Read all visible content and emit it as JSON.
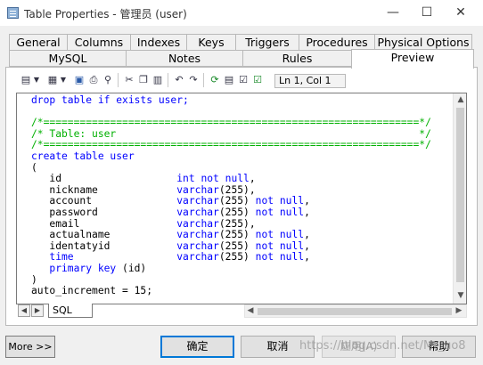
{
  "window": {
    "title": "Table Properties - 管理员 (user)",
    "minimize_glyph": "—",
    "maximize_glyph": "☐",
    "close_glyph": "✕"
  },
  "tabs_row1": [
    {
      "label": "General"
    },
    {
      "label": "Columns"
    },
    {
      "label": "Indexes"
    },
    {
      "label": "Keys"
    },
    {
      "label": "Triggers"
    },
    {
      "label": "Procedures"
    },
    {
      "label": "Physical Options"
    }
  ],
  "tabs_row2": [
    {
      "label": "MySQL"
    },
    {
      "label": "Notes"
    },
    {
      "label": "Rules"
    },
    {
      "label": "Preview",
      "active": true
    }
  ],
  "toolbar": {
    "icons": [
      "edit-menu-icon",
      "format-menu-icon",
      "save-icon",
      "print-icon",
      "find-icon",
      "cut-icon",
      "copy-icon",
      "paste-icon",
      "undo-icon",
      "redo-icon",
      "refresh-icon",
      "show-ddl-icon",
      "options-icon",
      "check-icon"
    ],
    "cursor_position": "Ln 1, Col 1"
  },
  "editor": {
    "lines": [
      [
        {
          "t": "drop table if exists user;",
          "c": "kw"
        }
      ],
      [
        {
          "t": "",
          "c": "pl"
        }
      ],
      [
        {
          "t": "/*==============================================================*/",
          "c": "cm"
        }
      ],
      [
        {
          "t": "/* Table: user                                                  */",
          "c": "cm"
        }
      ],
      [
        {
          "t": "/*==============================================================*/",
          "c": "cm"
        }
      ],
      [
        {
          "t": "create table user",
          "c": "kw"
        }
      ],
      [
        {
          "t": "(",
          "c": "pl"
        }
      ],
      [
        {
          "t": "   id                   ",
          "c": "pl"
        },
        {
          "t": "int not null",
          "c": "kw"
        },
        {
          "t": ",",
          "c": "pl"
        }
      ],
      [
        {
          "t": "   nickname             ",
          "c": "pl"
        },
        {
          "t": "varchar",
          "c": "kw"
        },
        {
          "t": "(255),",
          "c": "pl"
        }
      ],
      [
        {
          "t": "   account              ",
          "c": "pl"
        },
        {
          "t": "varchar",
          "c": "kw"
        },
        {
          "t": "(255) ",
          "c": "pl"
        },
        {
          "t": "not null",
          "c": "kw"
        },
        {
          "t": ",",
          "c": "pl"
        }
      ],
      [
        {
          "t": "   password             ",
          "c": "pl"
        },
        {
          "t": "varchar",
          "c": "kw"
        },
        {
          "t": "(255) ",
          "c": "pl"
        },
        {
          "t": "not null",
          "c": "kw"
        },
        {
          "t": ",",
          "c": "pl"
        }
      ],
      [
        {
          "t": "   email                ",
          "c": "pl"
        },
        {
          "t": "varchar",
          "c": "kw"
        },
        {
          "t": "(255),",
          "c": "pl"
        }
      ],
      [
        {
          "t": "   actualname           ",
          "c": "pl"
        },
        {
          "t": "varchar",
          "c": "kw"
        },
        {
          "t": "(255) ",
          "c": "pl"
        },
        {
          "t": "not null",
          "c": "kw"
        },
        {
          "t": ",",
          "c": "pl"
        }
      ],
      [
        {
          "t": "   identatyid           ",
          "c": "pl"
        },
        {
          "t": "varchar",
          "c": "kw"
        },
        {
          "t": "(255) ",
          "c": "pl"
        },
        {
          "t": "not null",
          "c": "kw"
        },
        {
          "t": ",",
          "c": "pl"
        }
      ],
      [
        {
          "t": "   time                 ",
          "c": "kw"
        },
        {
          "t": "varchar",
          "c": "kw"
        },
        {
          "t": "(255) ",
          "c": "pl"
        },
        {
          "t": "not null",
          "c": "kw"
        },
        {
          "t": ",",
          "c": "pl"
        }
      ],
      [
        {
          "t": "   primary key ",
          "c": "kw"
        },
        {
          "t": "(id)",
          "c": "pl"
        }
      ],
      [
        {
          "t": ")",
          "c": "pl"
        }
      ],
      [
        {
          "t": "auto_increment = 15;",
          "c": "pl"
        }
      ]
    ]
  },
  "bottom_tab": {
    "label": "SQL"
  },
  "buttons": {
    "more": "More >>",
    "ok": "确定",
    "cancel": "取消",
    "apply": "应用(A)",
    "help": "帮助"
  },
  "watermark": "https://blog.csdn.net/Mr_uo8"
}
